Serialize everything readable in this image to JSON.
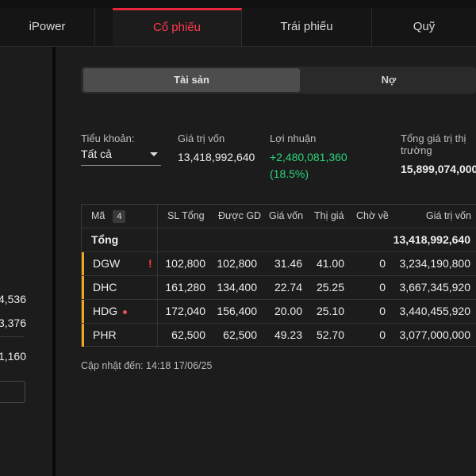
{
  "tabs": [
    {
      "label": "iPower"
    },
    {
      "label": "Cổ phiếu"
    },
    {
      "label": "Trái phiếu"
    },
    {
      "label": "Quỹ"
    }
  ],
  "left": {
    "v1": "4,536",
    "v2": "3,376",
    "v3": "1,160"
  },
  "toggle": {
    "assets": "Tài sản",
    "debt": "Nợ"
  },
  "summary": {
    "account_label": "Tiểu khoản:",
    "account_value": "Tất cả",
    "cost_label": "Giá trị vốn",
    "cost_value": "13,418,992,640",
    "profit_label": "Lợi nhuận",
    "profit_value": "+2,480,081,360",
    "profit_pct": "(18.5%)",
    "total_label_1": "Tổng giá trị thị",
    "total_label_2": "trường",
    "total_value": "15,899,074,000"
  },
  "table": {
    "headers": {
      "sym": "Mã",
      "count": "4",
      "qty": "SL Tổng",
      "tradable": "Được GD",
      "cost": "Giá vốn",
      "price": "Thị giá",
      "pending": "Chờ về",
      "value": "Giá trị vốn"
    },
    "total": {
      "label": "Tổng",
      "value": "13,418,992,640"
    },
    "rows": [
      {
        "sym": "DGW",
        "qty": "102,800",
        "tradable": "102,800",
        "cost": "31.46",
        "price": "41.00",
        "pending": "0",
        "value": "3,234,190,800"
      },
      {
        "sym": "DHC",
        "qty": "161,280",
        "tradable": "134,400",
        "cost": "22.74",
        "price": "25.25",
        "pending": "0",
        "value": "3,667,345,920"
      },
      {
        "sym": "HDG",
        "qty": "172,040",
        "tradable": "156,400",
        "cost": "20.00",
        "price": "25.10",
        "pending": "0",
        "value": "3,440,455,920"
      },
      {
        "sym": "PHR",
        "qty": "62,500",
        "tradable": "62,500",
        "cost": "49.23",
        "price": "52.70",
        "pending": "0",
        "value": "3,077,000,000"
      }
    ],
    "alert_mark": "!"
  },
  "updated": "Cập nhật đến: 14:18 17/06/25",
  "colors": {
    "accent_red": "#e8283a",
    "up_green": "#2bd47a",
    "row_accent": "#f0a61c"
  }
}
